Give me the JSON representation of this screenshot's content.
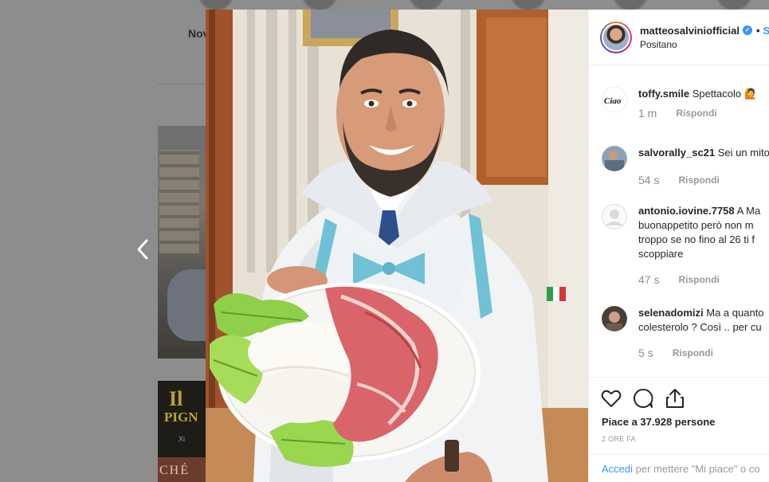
{
  "background": {
    "nav_label": "Nov"
  },
  "post": {
    "username": "matteosalviniofficial",
    "location": "Positano",
    "follow_dot": "•",
    "follow_label": "S",
    "likes_text": "Piace a 37.928 persone",
    "time_ago": "2 ORE FA"
  },
  "comments": [
    {
      "user": "toffy.smile",
      "text": "Spettacolo 🙋",
      "time": "1 m",
      "reply": "Rispondi"
    },
    {
      "user": "salvorally_sc21",
      "text": "Sei un mito",
      "time": "54 s",
      "reply": "Rispondi"
    },
    {
      "user": "antonio.iovine.7758",
      "text": "A Ma buonappetito però non m troppo se no fino al 26 ti f scoppiare",
      "time": "47 s",
      "reply": "Rispondi"
    },
    {
      "user": "selenadomizi",
      "text": "Ma a quanto colesterolo ? Così .. per cu",
      "time": "5 s",
      "reply": "Rispondi"
    }
  ],
  "footer": {
    "login_link": "Accedi",
    "login_text": " per mettere \"Mi piace\" o co"
  },
  "colors": {
    "accent": "#3897f0",
    "overlay": "#8e8e8e"
  },
  "icons": [
    "heart-icon",
    "comment-icon",
    "share-icon",
    "chevron-left-icon",
    "verified-badge-icon"
  ]
}
